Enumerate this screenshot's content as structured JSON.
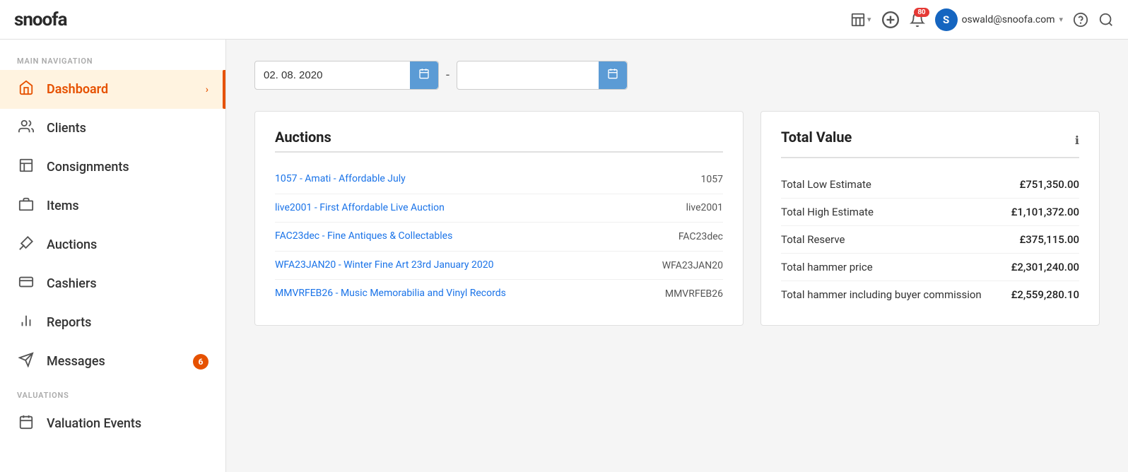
{
  "header": {
    "logo": "snoofa",
    "icons": {
      "building": "🏢",
      "add": "+",
      "bell": "🔔",
      "notification_count": "80",
      "user_initial": "S",
      "user_email": "oswald@snoofa.com",
      "help": "?",
      "search": "🔍"
    }
  },
  "sidebar": {
    "nav_label": "MAIN NAVIGATION",
    "items": [
      {
        "id": "dashboard",
        "label": "Dashboard",
        "icon": "house",
        "active": true
      },
      {
        "id": "clients",
        "label": "Clients",
        "icon": "clients",
        "active": false
      },
      {
        "id": "consignments",
        "label": "Consignments",
        "icon": "consignments",
        "active": false
      },
      {
        "id": "items",
        "label": "Items",
        "icon": "items",
        "active": false
      },
      {
        "id": "auctions",
        "label": "Auctions",
        "icon": "auctions",
        "active": false
      },
      {
        "id": "cashiers",
        "label": "Cashiers",
        "icon": "cashiers",
        "active": false
      },
      {
        "id": "reports",
        "label": "Reports",
        "icon": "reports",
        "active": false
      },
      {
        "id": "messages",
        "label": "Messages",
        "icon": "messages",
        "active": false,
        "badge": "6"
      }
    ],
    "valuations_label": "VALUATIONS",
    "valuations_items": [
      {
        "id": "valuation-events",
        "label": "Valuation Events",
        "icon": "calendar",
        "active": false
      }
    ]
  },
  "content": {
    "date_start": "02. 08. 2020",
    "date_end": "",
    "date_separator": "-",
    "auctions_card": {
      "title": "Auctions",
      "items": [
        {
          "label": "1057 - Amati - Affordable July",
          "code": "1057"
        },
        {
          "label": "live2001 - First Affordable Live Auction",
          "code": "live2001"
        },
        {
          "label": "FAC23dec - Fine Antiques & Collectables",
          "code": "FAC23dec"
        },
        {
          "label": "WFA23JAN20 - Winter Fine Art 23rd January 2020",
          "code": "WFA23JAN20"
        },
        {
          "label": "MMVRFEB26 - Music Memorabilia and Vinyl Records",
          "code": "MMVRFEB26"
        }
      ]
    },
    "total_value_card": {
      "title": "Total Value",
      "rows": [
        {
          "label": "Total Low Estimate",
          "value": "£751,350.00"
        },
        {
          "label": "Total High Estimate",
          "value": "£1,101,372.00"
        },
        {
          "label": "Total Reserve",
          "value": "£375,115.00"
        },
        {
          "label": "Total hammer price",
          "value": "£2,301,240.00"
        },
        {
          "label": "Total hammer including buyer commission",
          "value": "£2,559,280.10"
        }
      ]
    }
  }
}
